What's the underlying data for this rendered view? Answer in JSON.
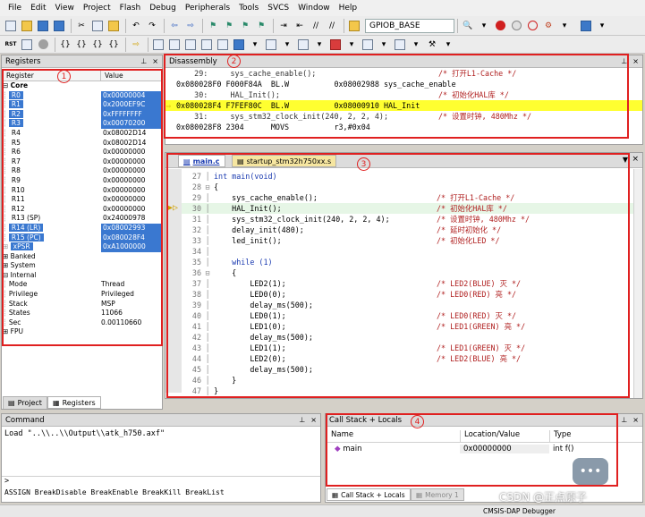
{
  "menu": [
    "File",
    "Edit",
    "View",
    "Project",
    "Flash",
    "Debug",
    "Peripherals",
    "Tools",
    "SVCS",
    "Window",
    "Help"
  ],
  "toolbar": {
    "target": "GPIOB_BASE"
  },
  "registers": {
    "title": "Registers",
    "col_register": "Register",
    "col_value": "Value",
    "core_label": "Core",
    "rows": [
      {
        "name": "R0",
        "value": "0x00000004",
        "sel": true
      },
      {
        "name": "R1",
        "value": "0x2000EF9C",
        "sel": true
      },
      {
        "name": "R2",
        "value": "0xFFFFFFFF",
        "sel": true
      },
      {
        "name": "R3",
        "value": "0x00070200",
        "sel": true
      },
      {
        "name": "R4",
        "value": "0x08002D14",
        "sel": false
      },
      {
        "name": "R5",
        "value": "0x08002D14",
        "sel": false
      },
      {
        "name": "R6",
        "value": "0x00000000",
        "sel": false
      },
      {
        "name": "R7",
        "value": "0x00000000",
        "sel": false
      },
      {
        "name": "R8",
        "value": "0x00000000",
        "sel": false
      },
      {
        "name": "R9",
        "value": "0x00000000",
        "sel": false
      },
      {
        "name": "R10",
        "value": "0x00000000",
        "sel": false
      },
      {
        "name": "R11",
        "value": "0x00000000",
        "sel": false
      },
      {
        "name": "R12",
        "value": "0x00000000",
        "sel": false
      },
      {
        "name": "R13 (SP)",
        "value": "0x24000978",
        "sel": false
      },
      {
        "name": "R14 (LR)",
        "value": "0x08002993",
        "sel": true
      },
      {
        "name": "R15 (PC)",
        "value": "0x080028F4",
        "sel": true
      },
      {
        "name": "xPSR",
        "value": "0xA1000000",
        "sel": true
      }
    ],
    "groups": [
      "Banked",
      "System",
      "Internal"
    ],
    "internal": [
      {
        "name": "Mode",
        "value": "Thread"
      },
      {
        "name": "Privilege",
        "value": "Privileged"
      },
      {
        "name": "Stack",
        "value": "MSP"
      },
      {
        "name": "States",
        "value": "11066"
      },
      {
        "name": "Sec",
        "value": "0.00110660"
      }
    ],
    "fpu_label": "FPU",
    "tab_project": "Project",
    "tab_registers": "Registers"
  },
  "disassembly": {
    "title": "Disassembly",
    "lines": [
      {
        "text": "    29:     sys_cache_enable();",
        "comment": "/* 打开L1-Cache */",
        "hl": false,
        "src": true
      },
      {
        "text": "0x080028F0 F000F84A  BL.W          0x08002988 sys_cache_enable",
        "comment": "",
        "hl": false,
        "src": false
      },
      {
        "text": "    30:     HAL_Init();",
        "comment": "/* 初始化HAL库 */",
        "hl": false,
        "src": true
      },
      {
        "text": "0x080028F4 F7FEF80C  BL.W          0x08000910 HAL_Init",
        "comment": "",
        "hl": true,
        "src": false
      },
      {
        "text": "    31:     sys_stm32_clock_init(240, 2, 2, 4);",
        "comment": "/* 设置时钟, 480Mhz */",
        "hl": false,
        "src": true
      },
      {
        "text": "0x080028F8 2304      MOVS          r3,#0x04",
        "comment": "",
        "hl": false,
        "src": false
      }
    ]
  },
  "editor": {
    "tabs": [
      "main.c",
      "startup_stm32h750xx.s"
    ],
    "lines": [
      {
        "n": "27",
        "code": "int main(void)",
        "comment": ""
      },
      {
        "n": "28",
        "code": "{",
        "comment": ""
      },
      {
        "n": "29",
        "code": "    sys_cache_enable();",
        "comment": "/* 打开L1-Cache */"
      },
      {
        "n": "30",
        "code": "    HAL_Init();",
        "comment": "/* 初始化HAL库 */"
      },
      {
        "n": "31",
        "code": "    sys_stm32_clock_init(240, 2, 2, 4);",
        "comment": "/* 设置时钟, 480Mhz */"
      },
      {
        "n": "32",
        "code": "    delay_init(480);",
        "comment": "/* 延时初始化 */"
      },
      {
        "n": "33",
        "code": "    led_init();",
        "comment": "/* 初始化LED */"
      },
      {
        "n": "34",
        "code": "",
        "comment": ""
      },
      {
        "n": "35",
        "code": "    while (1)",
        "comment": ""
      },
      {
        "n": "36",
        "code": "    {",
        "comment": ""
      },
      {
        "n": "37",
        "code": "        LED2(1);",
        "comment": "/* LED2(BLUE) 灭 */"
      },
      {
        "n": "38",
        "code": "        LED0(0);",
        "comment": "/* LED0(RED) 亮 */"
      },
      {
        "n": "39",
        "code": "        delay_ms(500);",
        "comment": ""
      },
      {
        "n": "40",
        "code": "        LED0(1);",
        "comment": "/* LED0(RED) 灭 */"
      },
      {
        "n": "41",
        "code": "        LED1(0);",
        "comment": "/* LED1(GREEN) 亮 */"
      },
      {
        "n": "42",
        "code": "        delay_ms(500);",
        "comment": ""
      },
      {
        "n": "43",
        "code": "        LED1(1);",
        "comment": "/* LED1(GREEN) 灭 */"
      },
      {
        "n": "44",
        "code": "        LED2(0);",
        "comment": "/* LED2(BLUE) 亮 */"
      },
      {
        "n": "45",
        "code": "        delay_ms(500);",
        "comment": ""
      },
      {
        "n": "46",
        "code": "    }",
        "comment": ""
      },
      {
        "n": "47",
        "code": "}",
        "comment": ""
      }
    ]
  },
  "command": {
    "title": "Command",
    "output": "Load \"..\\\\..\\\\Output\\\\atk_h750.axf\"",
    "prompt": ">",
    "hint": "ASSIGN BreakDisable BreakEnable BreakKill BreakList"
  },
  "callstack": {
    "title": "Call Stack + Locals",
    "col_name": "Name",
    "col_location": "Location/Value",
    "col_type": "Type",
    "row_name": "main",
    "row_location": "0x00000000",
    "row_type": "int f()",
    "tab_callstack": "Call Stack + Locals",
    "tab_memory": "Memory 1"
  },
  "status": {
    "debugger": "CMSIS-DAP Debugger",
    "watermark": "CSDN @正点原子"
  },
  "badges": [
    "1",
    "2",
    "3",
    "4"
  ]
}
